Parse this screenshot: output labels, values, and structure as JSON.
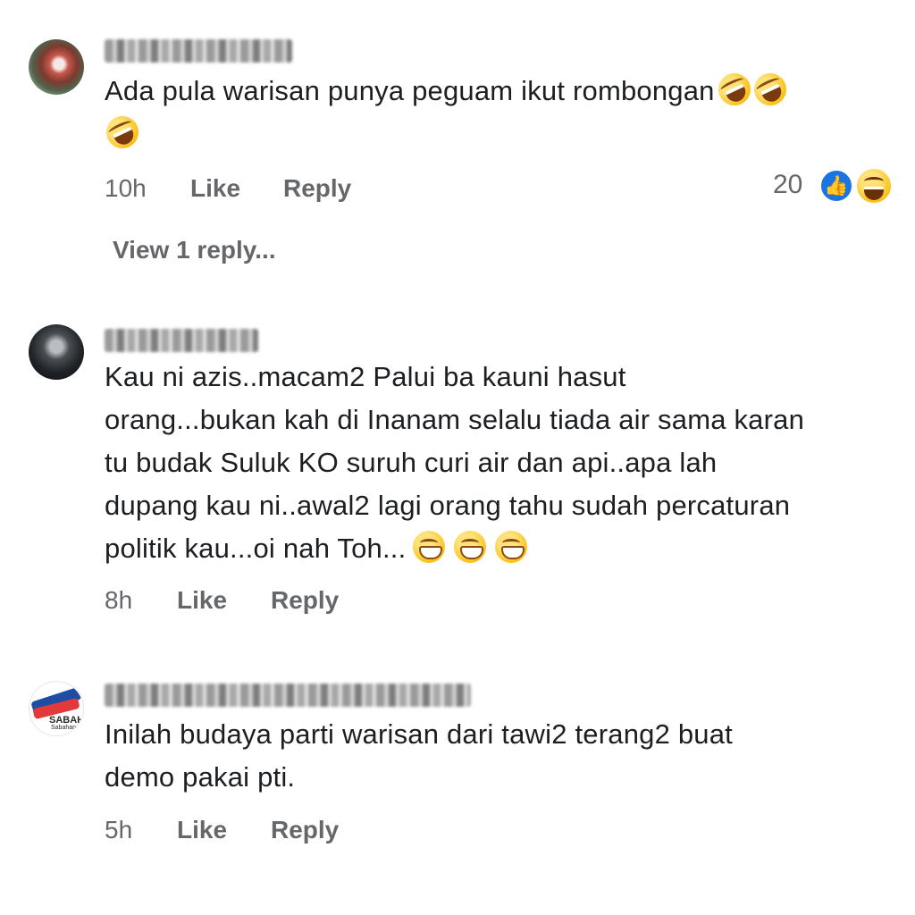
{
  "comments": [
    {
      "text": "Ada pula warisan punya peguam ikut rombongan",
      "time": "10h",
      "like_label": "Like",
      "reply_label": "Reply",
      "reaction_count": "20",
      "reactions": [
        "like-icon",
        "haha-icon"
      ],
      "view_replies": "View 1 reply..."
    },
    {
      "text_lines": [
        "Kau ni azis..macam2 Palui ba kauni hasut",
        "orang...bukan kah di Inanam selalu tiada air sama karan",
        "tu budak Suluk KO suruh curi air dan api..apa lah",
        "dupang kau ni..awal2 lagi orang tahu sudah percaturan",
        "politik kau...oi nah Toh..."
      ],
      "time": "8h",
      "like_label": "Like",
      "reply_label": "Reply"
    },
    {
      "text_lines": [
        "Inilah budaya parti warisan dari tawi2 terang2 buat",
        "demo pakai pti."
      ],
      "time": "5h",
      "like_label": "Like",
      "reply_label": "Reply",
      "avatar_logo": {
        "label": "SABAH",
        "sub": "Sabahan"
      }
    }
  ]
}
